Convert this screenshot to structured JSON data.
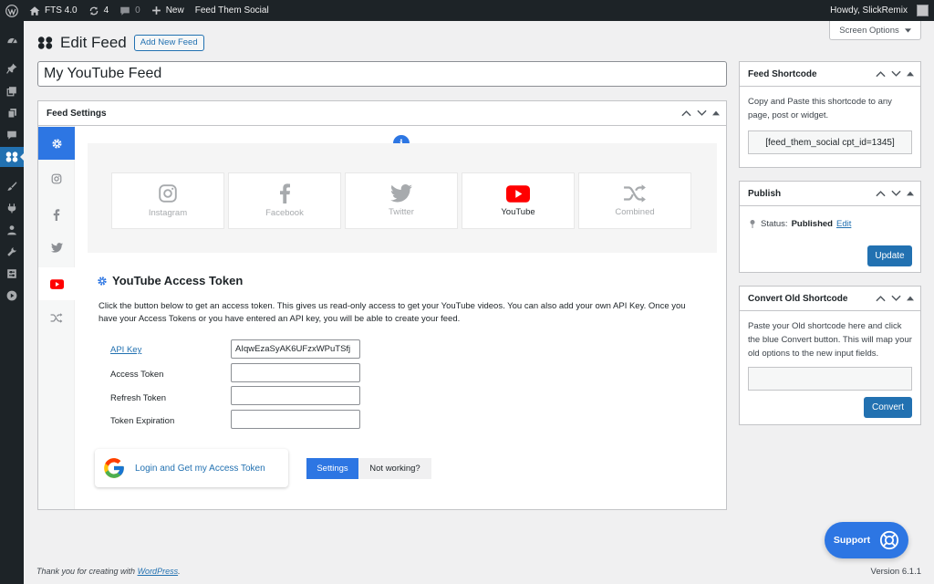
{
  "adminbar": {
    "site_name": "FTS 4.0",
    "updates_count": "4",
    "comments_count": "0",
    "new_label": "New",
    "plugin_link": "Feed Them Social",
    "howdy": "Howdy, SlickRemix"
  },
  "header": {
    "title": "Edit Feed",
    "add_new_label": "Add New Feed",
    "screen_options": "Screen Options"
  },
  "post_title": "My YouTube Feed",
  "feed_settings": {
    "heading": "Feed Settings",
    "social_cards": [
      {
        "label": "Instagram"
      },
      {
        "label": "Facebook"
      },
      {
        "label": "Twitter"
      },
      {
        "label": "YouTube"
      },
      {
        "label": "Combined"
      }
    ],
    "youtube": {
      "heading": "YouTube Access Token",
      "description": "Click the button below to get an access token. This gives us read-only access to get your YouTube videos. You can also add your own API Key. Once you have your Access Tokens or you have entered an API key, you will be able to create your feed.",
      "api_key_label": "API Key",
      "api_key_value": "AIqwEzaSyAK6UFzxWPuTSfj",
      "access_token_label": "Access Token",
      "access_token_value": "",
      "refresh_token_label": "Refresh Token",
      "refresh_token_value": "",
      "token_expiration_label": "Token Expiration",
      "token_expiration_value": "",
      "login_button": "Login and Get my Access Token",
      "settings_button": "Settings",
      "not_working_button": "Not working?"
    }
  },
  "shortcode_box": {
    "heading": "Feed Shortcode",
    "description": "Copy and Paste this shortcode to any page, post or widget.",
    "shortcode": "[feed_them_social cpt_id=1345]"
  },
  "publish_box": {
    "heading": "Publish",
    "status_label": "Status:",
    "status_value": "Published",
    "edit_link": "Edit",
    "update_button": "Update"
  },
  "convert_box": {
    "heading": "Convert Old Shortcode",
    "description": "Paste your Old shortcode here and click the blue Convert button. This will map your old options to the new input fields.",
    "convert_button": "Convert"
  },
  "support_label": "Support",
  "footer": {
    "thanks_prefix": "Thank you for creating with ",
    "wordpress_link": "WordPress",
    "thanks_suffix": ".",
    "version": "Version 6.1.1"
  },
  "colors": {
    "admin_dark": "#1d2327",
    "wp_blue": "#2271b1",
    "fts_blue": "#2d76e3",
    "youtube_red": "#ff0000"
  }
}
